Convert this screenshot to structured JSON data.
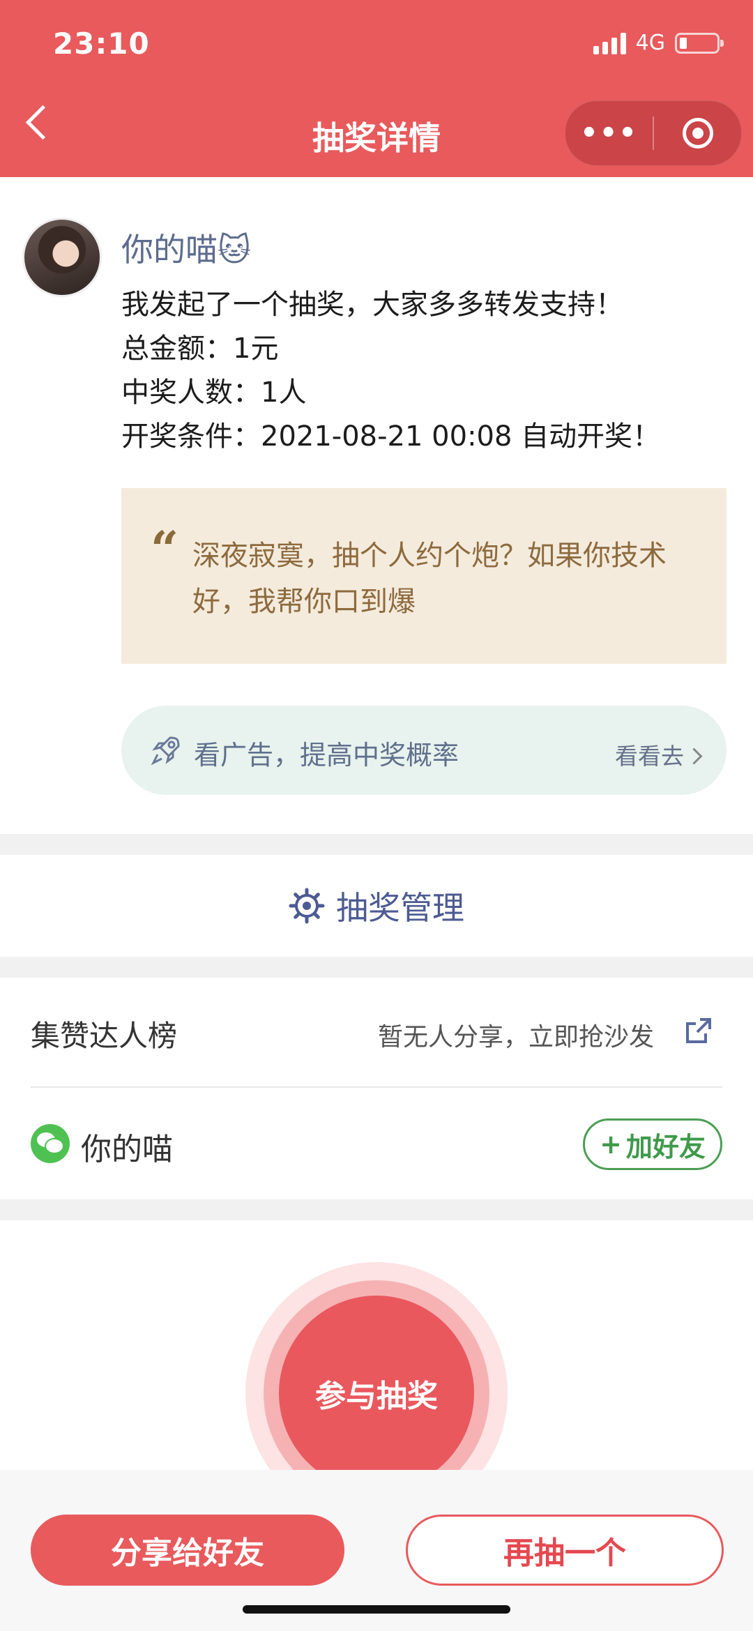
{
  "status_bar": {
    "time": "23:10",
    "network": "4G"
  },
  "nav": {
    "title": "抽奖详情",
    "more_label": "•••"
  },
  "post": {
    "username": "你的喵🐱",
    "lines": [
      "我发起了一个抽奖，大家多多转发支持！",
      "总金额：1元",
      "中奖人数：1人",
      "开奖条件：2021-08-21 00:08 自动开奖！"
    ],
    "quote_mark": "“",
    "quote": "深夜寂寞，抽个人约个炮？如果你技术好，我帮你口到爆"
  },
  "ad": {
    "text": "看广告，提高中奖概率",
    "link": "看看去"
  },
  "manage": {
    "label": "抽奖管理"
  },
  "ranking": {
    "title": "集赞达人榜",
    "empty_text": "暂无人分享，立即抢沙发",
    "friend_name": "你的喵",
    "add_friend": "加好友"
  },
  "draw_button": "参与抽奖",
  "bottom": {
    "share": "分享给好友",
    "again": "再抽一个"
  },
  "colors": {
    "brand_red": "#e85a5c",
    "quote_bg": "#f4ebdc",
    "ad_bg": "#e8f2ee",
    "wechat_green": "#4fc152"
  }
}
